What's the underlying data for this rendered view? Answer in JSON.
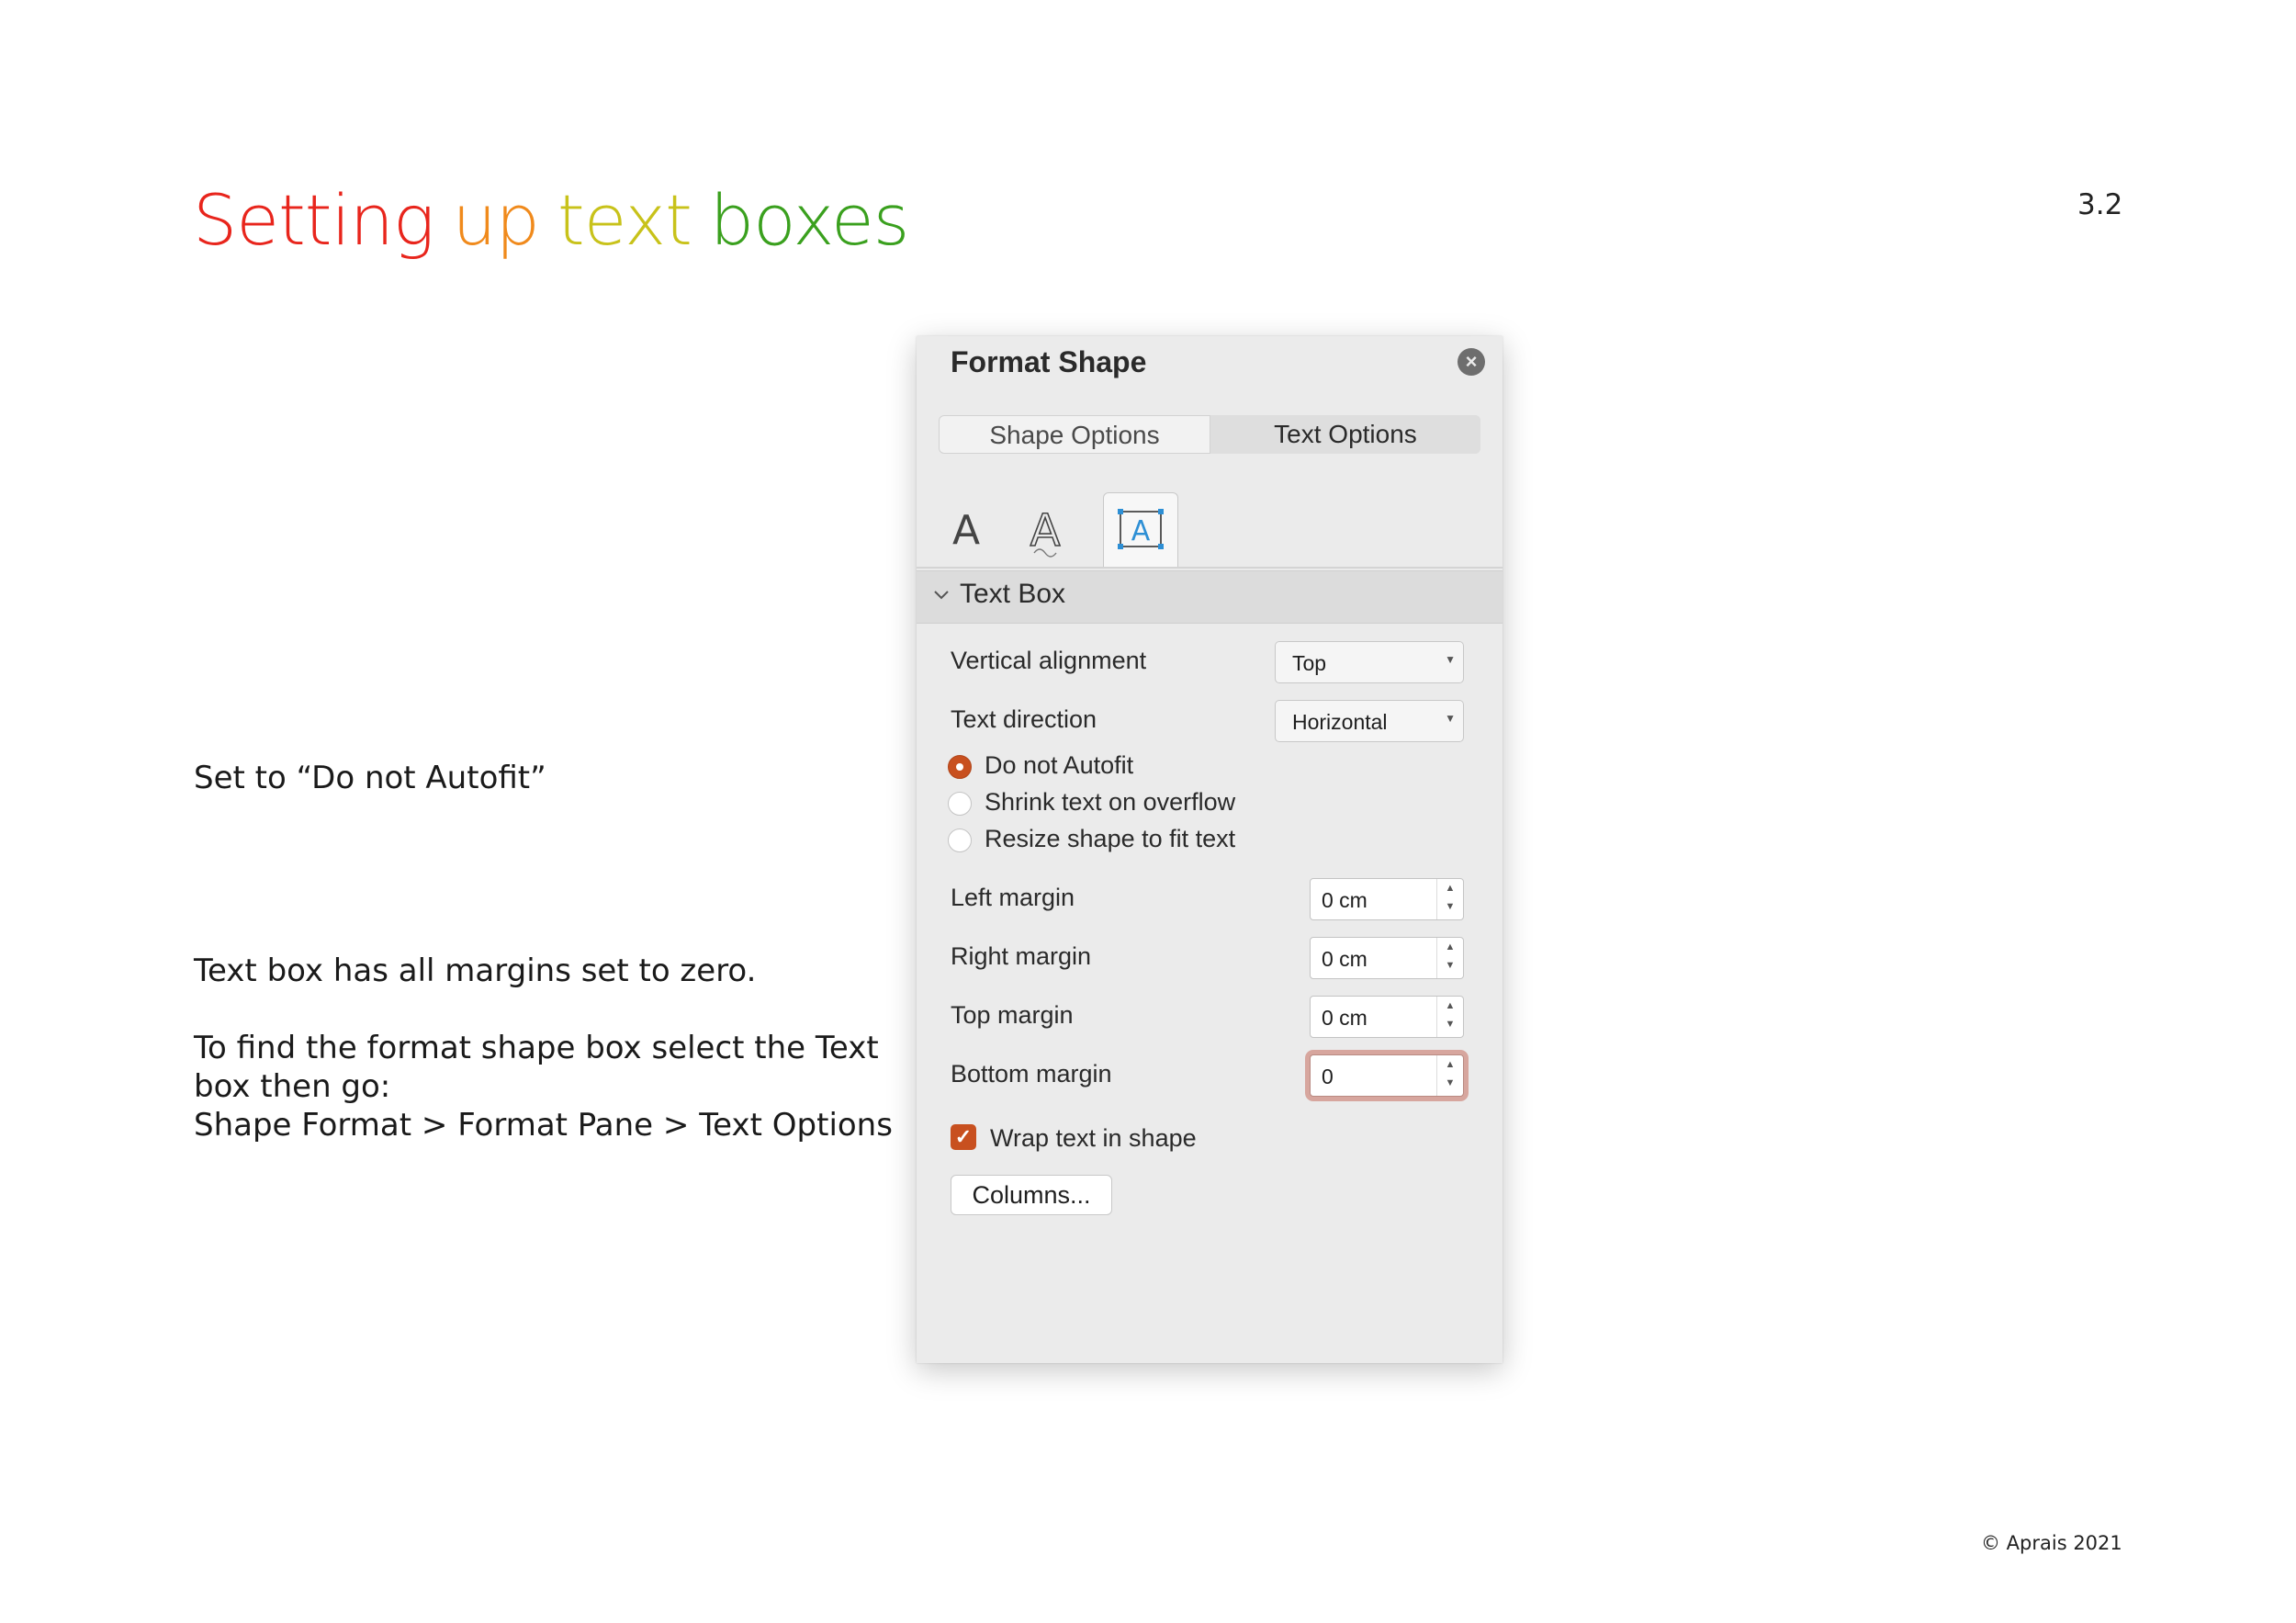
{
  "slide": {
    "title_words": [
      {
        "text": "Setting",
        "color": "#e8251c"
      },
      {
        "text": "up",
        "color": "#f08a1c"
      },
      {
        "text": "text",
        "color": "#c8c21a"
      },
      {
        "text": "boxes",
        "color": "#3aa01e"
      }
    ],
    "number": "3.2",
    "note_autofit": "Set to “Do not Autofit”",
    "note_margins": "Text box has all margins set to zero.",
    "note_find_line1": "To find the format shape box select the Text",
    "note_find_line2": "box then go:",
    "note_find_line3": "Shape Format > Format Pane > Text Options",
    "footer": "© Aprais 2021"
  },
  "pane": {
    "title": "Format Shape",
    "close_icon": "close-icon",
    "tabs": {
      "shape_options": "Shape Options",
      "text_options": "Text Options"
    },
    "icon_tabs": [
      "text-fill-icon",
      "text-outline-icon",
      "text-box-icon"
    ],
    "section_title": "Text Box",
    "vertical_alignment": {
      "label": "Vertical alignment",
      "value": "Top"
    },
    "text_direction": {
      "label": "Text direction",
      "value": "Horizontal"
    },
    "autofit_options": [
      {
        "label": "Do not Autofit",
        "selected": true
      },
      {
        "label": "Shrink text on overflow",
        "selected": false
      },
      {
        "label": "Resize shape to fit text",
        "selected": false
      }
    ],
    "margins": {
      "left": {
        "label": "Left margin",
        "value": "0 cm"
      },
      "right": {
        "label": "Right margin",
        "value": "0 cm"
      },
      "top": {
        "label": "Top margin",
        "value": "0 cm"
      },
      "bottom": {
        "label": "Bottom margin",
        "value": "0"
      }
    },
    "wrap_text": {
      "label": "Wrap text in shape",
      "checked": true
    },
    "columns_button": "Columns..."
  },
  "colors": {
    "accent": "#c8501f",
    "focus_ring": "#d7a69e",
    "pane_bg": "#ebebeb"
  }
}
